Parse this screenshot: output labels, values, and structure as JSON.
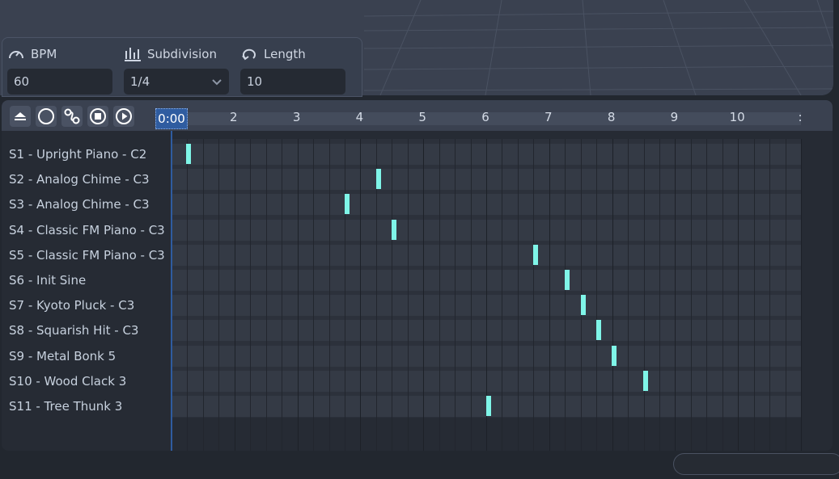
{
  "settings": {
    "bpm": {
      "label": "BPM",
      "value": "60",
      "icon": "gauge-icon"
    },
    "subdivision": {
      "label": "Subdivision",
      "value": "1/4",
      "icon": "bar-chart-icon"
    },
    "length": {
      "label": "Length",
      "value": "10",
      "icon": "loop-icon"
    }
  },
  "toolbar": {
    "time": "0:00",
    "buttons": [
      "eject-icon",
      "record-icon",
      "link-icon",
      "stop-icon",
      "play-icon"
    ]
  },
  "ruler": {
    "marks": [
      "2",
      "3",
      "4",
      "5",
      "6",
      "7",
      "8",
      "9",
      "10",
      ":"
    ]
  },
  "tracks": [
    {
      "label": "S1 - Upright Piano - C2",
      "note_at": 1.28
    },
    {
      "label": "S2 - Analog Chime - C3",
      "note_at": 4.3
    },
    {
      "label": "S3 - Analog Chime - C3",
      "note_at": 3.8
    },
    {
      "label": "S4 - Classic FM Piano - C3",
      "note_at": 4.55
    },
    {
      "label": "S5 - Classic FM Piano - C3",
      "note_at": 6.8
    },
    {
      "label": "S6 - Init Sine",
      "note_at": 7.3
    },
    {
      "label": "S7 - Kyoto Pluck - C3",
      "note_at": 7.55
    },
    {
      "label": "S8 - Squarish Hit - C3",
      "note_at": 7.8
    },
    {
      "label": "S9 - Metal Bonk 5",
      "note_at": 8.05
    },
    {
      "label": "S10 - Wood Clack 3",
      "note_at": 8.55
    },
    {
      "label": "S11 - Tree Thunk 3",
      "note_at": 6.05
    }
  ],
  "colors": {
    "note": "#7ff5e8",
    "accent": "#2f5ca0"
  }
}
